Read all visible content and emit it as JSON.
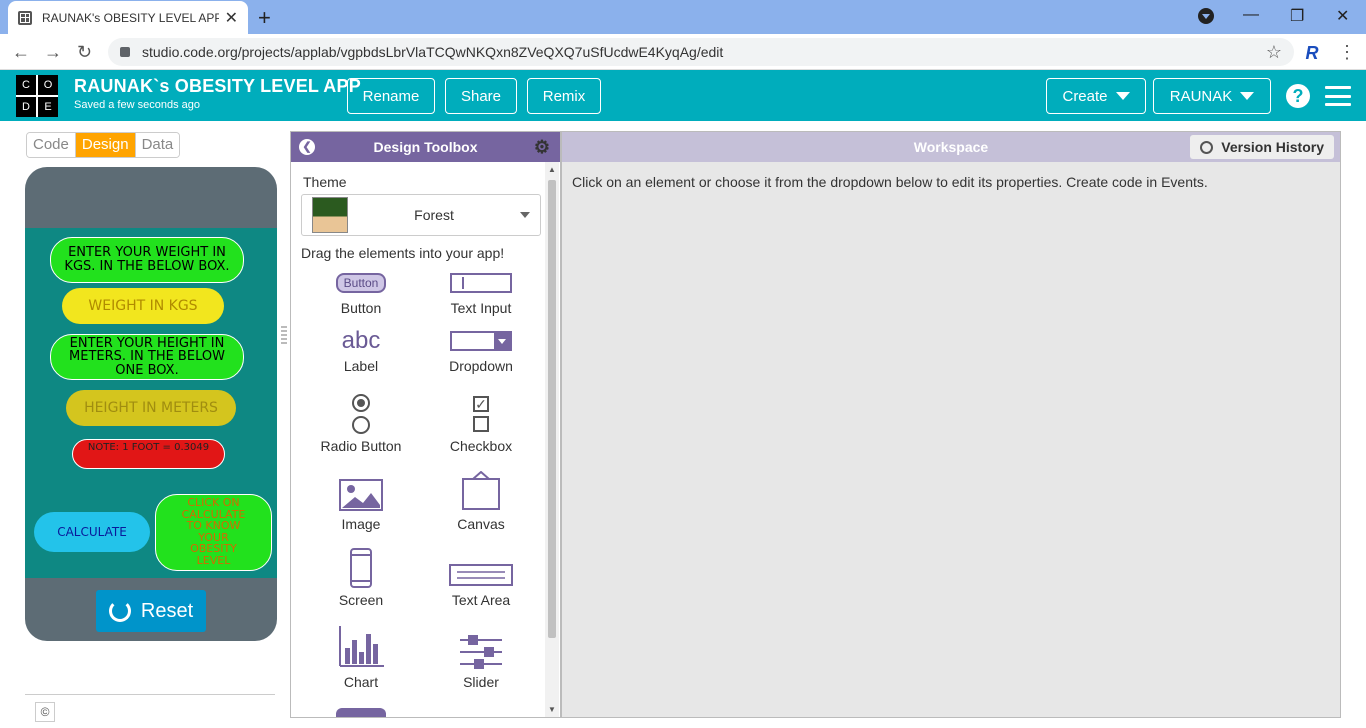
{
  "browser": {
    "tab_title": "RAUNAK's OBESITY LEVEL APP -",
    "url": "studio.code.org/projects/applab/vgpbdsLbrVlaTCQwNKQxn8ZVeQXQ7uSfUcdwE4KyqAg/edit",
    "profile_initial": "R"
  },
  "header": {
    "logo_letters": [
      "C",
      "O",
      "D",
      "E"
    ],
    "project_name": "RAUNAK`s OBESITY LEVEL APP",
    "saved_status": "Saved a few seconds ago",
    "rename_label": "Rename",
    "share_label": "Share",
    "remix_label": "Remix",
    "create_label": "Create",
    "user_label": "RAUNAK",
    "help_glyph": "?"
  },
  "modes": {
    "code": "Code",
    "design": "Design",
    "data": "Data"
  },
  "app_preview": {
    "weight_prompt": "ENTER YOUR WEIGHT IN KGS. IN THE BELOW BOX.",
    "weight_input": "WEIGHT IN KGS",
    "height_prompt": "ENTER YOUR HEIGHT IN METERS. IN THE BELOW ONE BOX.",
    "height_input": "HEIGHT IN METERS",
    "note": "NOTE: 1 FOOT = 0.3049",
    "calculate_button": "CALCULATE",
    "click_hint": "CLICK ON CALCULATE TO KNOW YOUR OBESITY LEVEL",
    "reset_label": "Reset"
  },
  "toolbox": {
    "title": "Design Toolbox",
    "theme_label": "Theme",
    "theme_value": "Forest",
    "drag_hint": "Drag the elements into your app!",
    "button_sample": "Button",
    "label_sample": "abc",
    "tools": {
      "button": "Button",
      "text_input": "Text Input",
      "label": "Label",
      "dropdown": "Dropdown",
      "radio": "Radio Button",
      "checkbox": "Checkbox",
      "image": "Image",
      "canvas": "Canvas",
      "screen": "Screen",
      "text_area": "Text Area",
      "chart": "Chart",
      "slider": "Slider"
    }
  },
  "workspace": {
    "title": "Workspace",
    "version_history": "Version History",
    "hint": "Click on an element or choose it from the dropdown below to edit its properties. Create code in Events."
  },
  "footer": {
    "copyright_glyph": "©"
  },
  "colors": {
    "header": "#00adbc",
    "toolbox_header": "#7665a0",
    "design_active": "#ffa400",
    "phone_screen": "#0e8883",
    "green_box": "#22e11d",
    "yellow_box": "#f2e61e",
    "red_box": "#e11616"
  }
}
